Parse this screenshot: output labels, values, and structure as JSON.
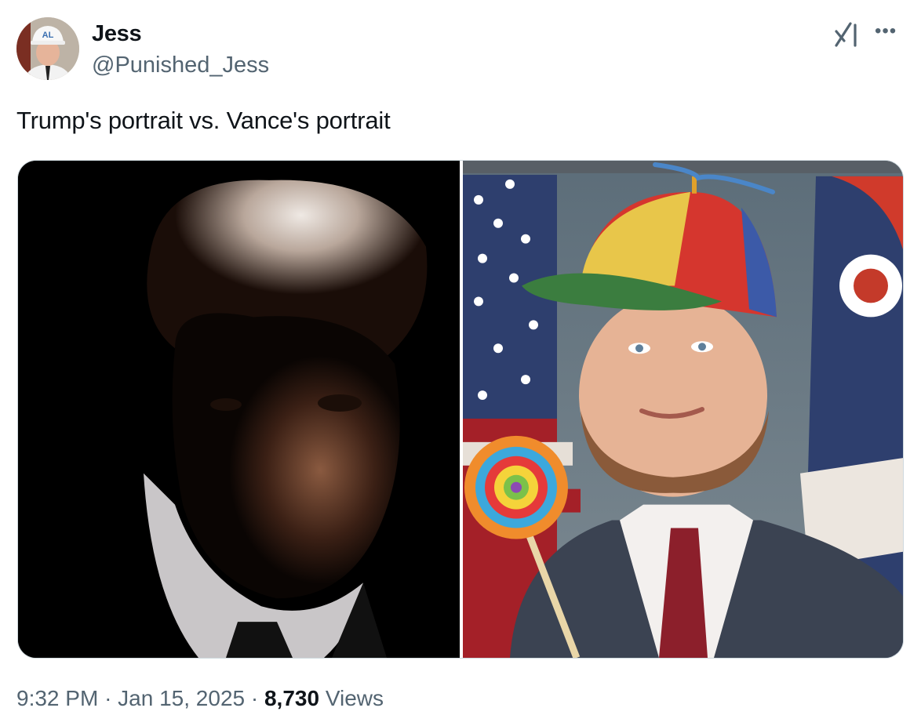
{
  "author": {
    "display_name": "Jess",
    "handle": "@Punished_Jess",
    "avatar_badge": "AL"
  },
  "tweet": {
    "text": "Trump's portrait vs. Vance's portrait"
  },
  "media": {
    "count": 2,
    "items": [
      "left-portrait-photo",
      "right-portrait-photo"
    ]
  },
  "meta": {
    "time": "9:32 PM",
    "separator": "·",
    "date": "Jan 15, 2025",
    "views_count": "8,730",
    "views_label": "Views"
  },
  "icons": {
    "grok": "grok-icon",
    "more": "more-icon"
  },
  "colors": {
    "text_primary": "#0f1419",
    "text_secondary": "#536471",
    "border": "#cfd9de"
  }
}
